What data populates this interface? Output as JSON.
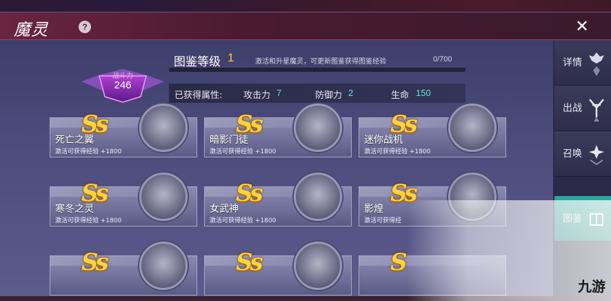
{
  "window": {
    "title": "魔灵",
    "help_label": "?",
    "close_label": "✕"
  },
  "tabs": [
    {
      "label": "详情",
      "icon": "crest-icon"
    },
    {
      "label": "出战",
      "icon": "crossed-swords-icon"
    },
    {
      "label": "召唤",
      "icon": "summon-icon"
    },
    {
      "label": "图鉴",
      "icon": "book-icon",
      "active": true
    }
  ],
  "power": {
    "label": "战斗力",
    "value": "246"
  },
  "codex": {
    "title": "图鉴等级",
    "level": "1",
    "hint": "激活和升星魔灵，可更新图鉴获得图鉴经验",
    "progress": "0/700",
    "progress_fraction": 0.0
  },
  "attributes": {
    "label": "已获得属性:",
    "items": [
      {
        "name": "攻击力",
        "value": "7"
      },
      {
        "name": "防御力",
        "value": "2"
      },
      {
        "name": "生命",
        "value": "150"
      }
    ]
  },
  "cards": [
    {
      "grade": "Ss",
      "name": "死亡之翼",
      "reward": "激活可获得经验 +1800"
    },
    {
      "grade": "Ss",
      "name": "暗影门徒",
      "reward": "激活可获得经验 +1800"
    },
    {
      "grade": "Ss",
      "name": "迷你战机",
      "reward": "激活可获得经验 +1800"
    },
    {
      "grade": "Ss",
      "name": "寒冬之灵",
      "reward": "激活可获得经验 +1800"
    },
    {
      "grade": "Ss",
      "name": "女武神",
      "reward": "激活可获得经验 +1800"
    },
    {
      "grade": "Ss",
      "name": "影煌",
      "reward": "激活可获得经"
    },
    {
      "grade": "Ss",
      "name": "",
      "reward": ""
    },
    {
      "grade": "Ss",
      "name": "",
      "reward": ""
    },
    {
      "grade": "S",
      "name": "",
      "reward": ""
    }
  ],
  "watermark": {
    "text": "九游"
  },
  "colors": {
    "accent": "#ffcc33",
    "stat": "#5de8d8",
    "active_tab": "#2aa8a0"
  }
}
